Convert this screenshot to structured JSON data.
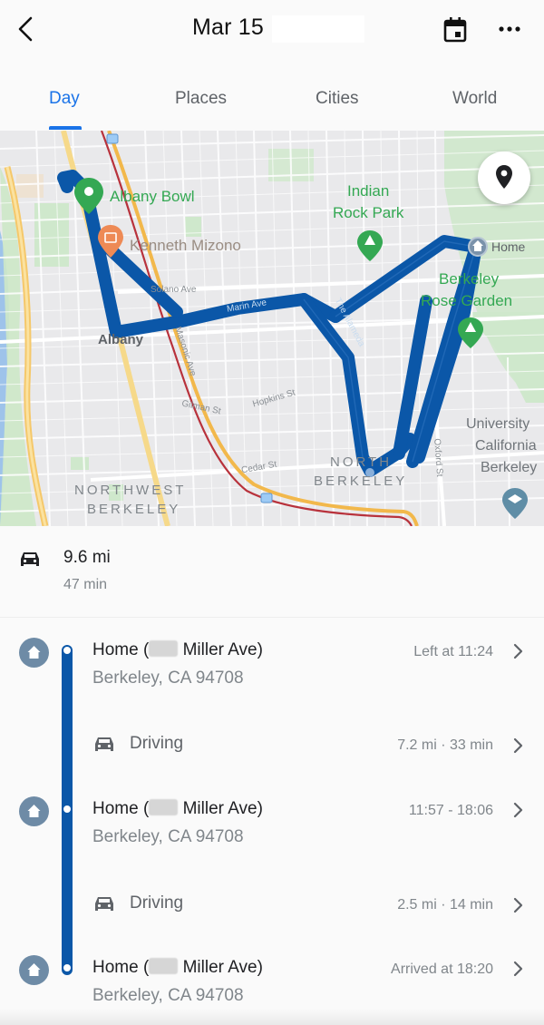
{
  "header": {
    "title": "Mar 15",
    "back_icon": "chevron-left-icon",
    "calendar_icon": "calendar-icon",
    "more_icon": "more-horizontal-icon"
  },
  "tabs": [
    {
      "label": "Day",
      "active": true
    },
    {
      "label": "Places",
      "active": false
    },
    {
      "label": "Cities",
      "active": false
    },
    {
      "label": "World",
      "active": false
    }
  ],
  "map": {
    "route_color": "#0b57a8",
    "places": [
      {
        "label": "Albany Bowl",
        "type": "visited-pin",
        "color": "#34a853"
      },
      {
        "label": "Kenneth Mizono",
        "type": "restaurant-pin",
        "color": "#ee8a55"
      },
      {
        "label": "Indian",
        "label2": "Rock Park",
        "type": "park-pin",
        "color": "#34a853"
      },
      {
        "label": "Home",
        "type": "home-marker",
        "color": "#7a92ab"
      },
      {
        "label": "Berkeley",
        "label2": "Rose Garden",
        "type": "park-pin",
        "color": "#34a853"
      },
      {
        "label": "University",
        "label2": "California",
        "label3": "Berkeley",
        "type": "school-pin",
        "color": "#5f8da6"
      }
    ],
    "areas": [
      {
        "label": "Albany"
      },
      {
        "label": "NORTHWEST",
        "label2": "BERKELEY"
      },
      {
        "label": "NORTH",
        "label2": "BERKELEY"
      }
    ],
    "streets": [
      "Solano Ave",
      "Marin Ave",
      "The Alameda",
      "Masonic Ave",
      "Gilman St",
      "Hopkins St",
      "Cedar St",
      "Oxford St"
    ],
    "locate_button_icon": "map-pin-icon"
  },
  "summary": {
    "icon": "car-icon",
    "distance": "9.6 mi",
    "duration": "47 min"
  },
  "timeline": {
    "line_color": "#0b57a8",
    "entries": [
      {
        "kind": "place",
        "name_prefix": "Home (",
        "name_suffix": " Miller Ave)",
        "address": "Berkeley, CA 94708",
        "meta": "Left at 11:24"
      },
      {
        "kind": "move",
        "label": "Driving",
        "meta": "7.2 mi · 33 min"
      },
      {
        "kind": "place",
        "name_prefix": "Home (",
        "name_suffix": " Miller Ave)",
        "address": "Berkeley, CA 94708",
        "meta": "11:57 - 18:06"
      },
      {
        "kind": "move",
        "label": "Driving",
        "meta": "2.5 mi · 14 min"
      },
      {
        "kind": "place",
        "name_prefix": "Home (",
        "name_suffix": " Miller Ave)",
        "address": "Berkeley, CA 94708",
        "meta": "Arrived at 18:20"
      }
    ]
  }
}
